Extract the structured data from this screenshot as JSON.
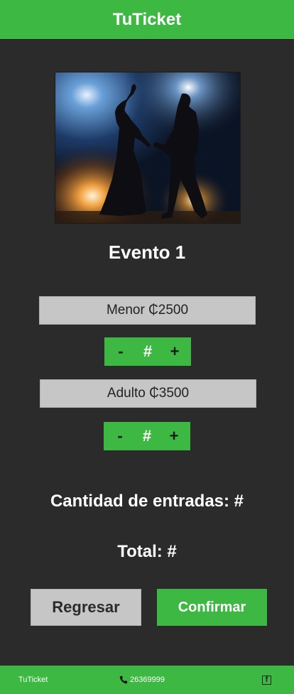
{
  "header": {
    "title": "TuTicket"
  },
  "event": {
    "title": "Evento 1",
    "image_icon": "dancers-photo"
  },
  "tickets": [
    {
      "label": "Menor  ₵2500",
      "qty": "#",
      "minus": "-",
      "plus": "+"
    },
    {
      "label": "Adulto  ₵3500",
      "qty": "#",
      "minus": "-",
      "plus": "+"
    }
  ],
  "summary": {
    "quantity_text": "Cantidad de entradas: #",
    "total_text": "Total: #"
  },
  "actions": {
    "back_label": "Regresar",
    "confirm_label": "Confirmar"
  },
  "footer": {
    "brand": "TuTicket",
    "phone": "26369999",
    "phone_icon": "phone-icon",
    "social_icon": "facebook-icon"
  },
  "colors": {
    "accent": "#3db843",
    "background": "#2b2b2b",
    "neutral": "#c6c6c6"
  }
}
